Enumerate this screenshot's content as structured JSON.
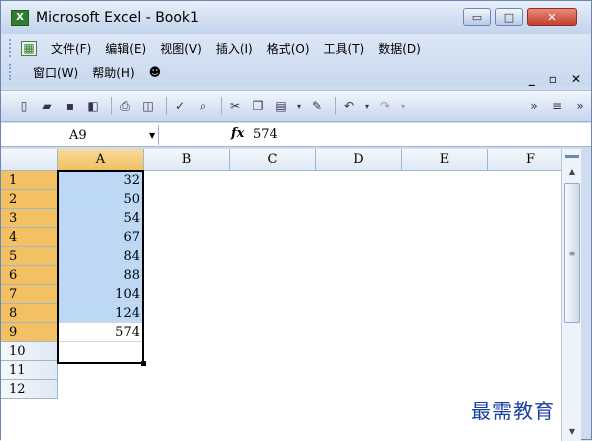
{
  "window": {
    "title": "Microsoft Excel - Book1",
    "app_icon": "X"
  },
  "menus_row1": [
    "文件(F)",
    "编辑(E)",
    "视图(V)",
    "插入(I)",
    "格式(O)",
    "工具(T)",
    "数据(D)"
  ],
  "menus_row2": [
    "窗口(W)",
    "帮助(H)"
  ],
  "formula_bar": {
    "name_box": "A9",
    "fx": "fx",
    "value": "574"
  },
  "columns": [
    "A",
    "B",
    "C",
    "D",
    "E",
    "F"
  ],
  "rows": [
    "1",
    "2",
    "3",
    "4",
    "5",
    "6",
    "7",
    "8",
    "9",
    "10",
    "11",
    "12"
  ],
  "column_a_values": [
    "32",
    "50",
    "54",
    "67",
    "84",
    "88",
    "104",
    "124",
    "574"
  ],
  "watermark": "最需教育",
  "colors": {
    "selection": "#bcd8f5",
    "header_selected": "#f4c064",
    "watermark": "#1a3fa0"
  }
}
